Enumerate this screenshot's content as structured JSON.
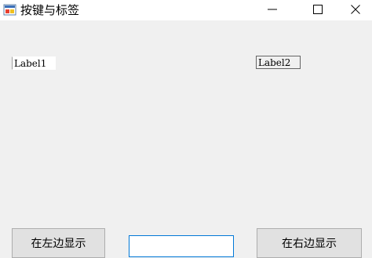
{
  "window": {
    "title": "按键与标签",
    "controls": {
      "minimize": "minimize",
      "maximize": "maximize",
      "close": "close"
    }
  },
  "labels": {
    "label1": "Label1",
    "label2": "Label2"
  },
  "buttons": {
    "show_left": "在左边显示",
    "show_right": "在右边显示"
  },
  "textbox": {
    "value": "",
    "placeholder": ""
  },
  "colors": {
    "form_background": "#f0f0f0",
    "titlebar_background": "#ffffff",
    "textbox_focus_border": "#0078d7",
    "button_face": "#e1e1e1",
    "button_border": "#adadad"
  },
  "icons": {
    "app": "app-window-icon",
    "minimize": "minimize-icon",
    "maximize": "maximize-icon",
    "close": "close-icon"
  }
}
